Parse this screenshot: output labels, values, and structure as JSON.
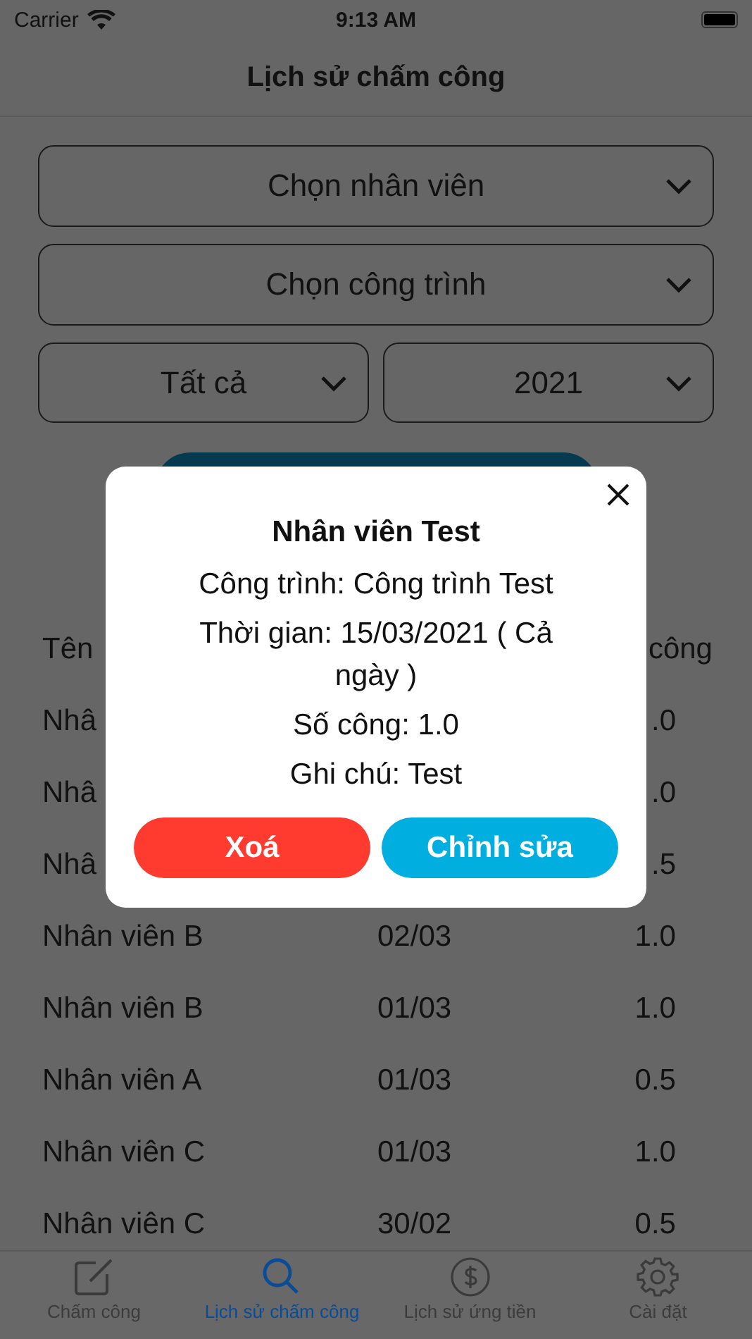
{
  "status_bar": {
    "carrier": "Carrier",
    "time": "9:13 AM"
  },
  "nav": {
    "title": "Lịch sử chấm công"
  },
  "filters": [
    {
      "kind": "wide",
      "value": "Chọn nhân viên"
    },
    {
      "kind": "wide",
      "value": "Chọn công trình"
    },
    {
      "kind": "half",
      "value": "Tất cả"
    },
    {
      "kind": "half",
      "value": "2021"
    }
  ],
  "table": {
    "columns": {
      "column_1": "Tên",
      "column_3": "công"
    },
    "rows": [
      {
        "name": "Nhâ",
        "value": ".0"
      },
      {
        "name": "Nhâ",
        "value": ".0"
      },
      {
        "name": "Nhâ",
        "value": ".5"
      },
      {
        "name": "Nhân viên B",
        "date": "02/03",
        "value": "1.0"
      },
      {
        "name": "Nhân viên B",
        "date": "01/03",
        "value": "1.0"
      },
      {
        "name": "Nhân viên A",
        "date": "01/03",
        "value": "0.5"
      },
      {
        "name": "Nhân viên C",
        "date": "01/03",
        "value": "1.0"
      },
      {
        "name": "Nhân viên C",
        "date": "30/02",
        "value": "0.5"
      }
    ]
  },
  "dialog": {
    "title": "Nhân viên Test",
    "lines": [
      "Công trình: Công trình Test",
      "Thời gian: 15/03/2021 ( Cả ngày )",
      "Số công: 1.0",
      "Ghi chú: Test"
    ],
    "buttons": [
      {
        "kind": "delete",
        "label": "Xoá"
      },
      {
        "kind": "edit",
        "label": "Chỉnh sửa"
      }
    ]
  },
  "tab_bar": [
    {
      "label": "Chấm công",
      "selected": false
    },
    {
      "label": "Lịch sử chấm công",
      "selected": true
    },
    {
      "label": "Lịch sử ứng tiền",
      "selected": false
    },
    {
      "label": "Cài đặt",
      "selected": false
    }
  ]
}
